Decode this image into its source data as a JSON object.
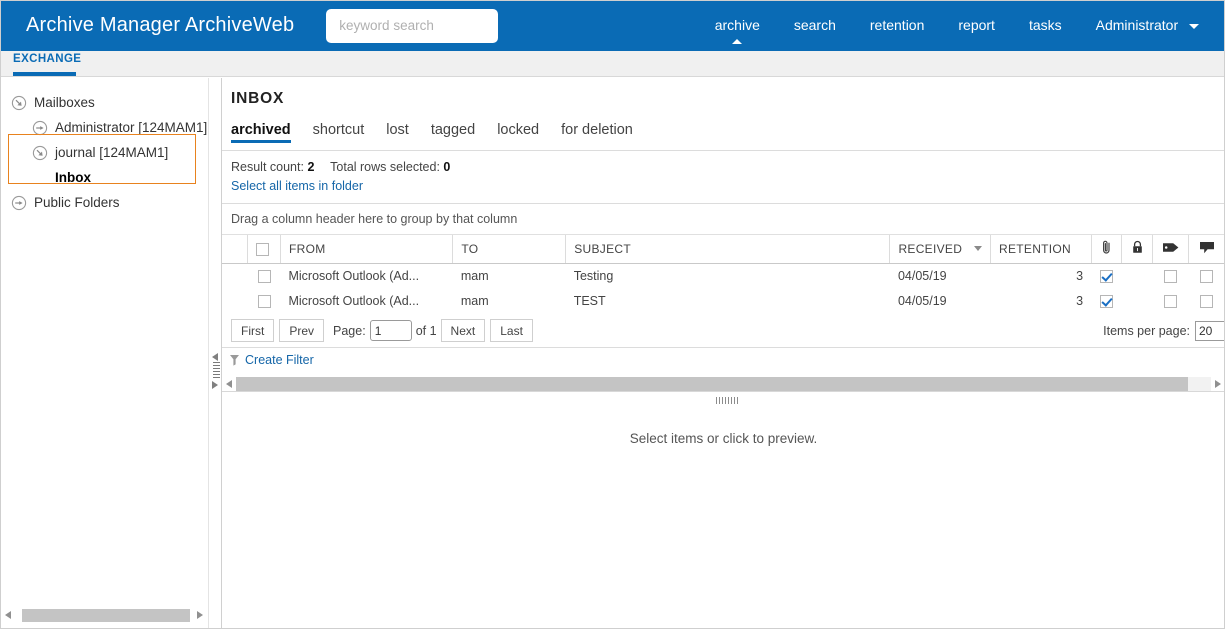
{
  "app": {
    "brand": "Archive Manager ArchiveWeb",
    "accent_blue": "#0a6bb5",
    "selection_orange": "#e8821e",
    "link_blue": "#1566a8"
  },
  "search": {
    "placeholder": "keyword search",
    "value": ""
  },
  "topnav": {
    "items": [
      {
        "label": "archive",
        "active": true
      },
      {
        "label": "search",
        "active": false
      },
      {
        "label": "retention",
        "active": false
      },
      {
        "label": "report",
        "active": false
      },
      {
        "label": "tasks",
        "active": false
      }
    ],
    "user_label": "Administrator"
  },
  "module_tab": {
    "label": "EXCHANGE"
  },
  "sidebar": {
    "tree": [
      {
        "label": "Mailboxes",
        "level": 0,
        "icon": "expanded-node-icon",
        "bold": false
      },
      {
        "label": "Administrator [124MAM1]",
        "level": 1,
        "icon": "collapsed-node-icon",
        "bold": false
      },
      {
        "label": "journal [124MAM1]",
        "level": 1,
        "icon": "expanded-node-icon",
        "bold": false
      },
      {
        "label": "Inbox",
        "level": 2,
        "icon": "none",
        "bold": true
      },
      {
        "label": "Public Folders",
        "level": 0,
        "icon": "collapsed-node-icon",
        "bold": false
      }
    ],
    "selected_label": "journal [124MAM1]"
  },
  "main": {
    "page_title": "INBOX",
    "tabs": [
      {
        "label": "archived",
        "active": true
      },
      {
        "label": "shortcut",
        "active": false
      },
      {
        "label": "lost",
        "active": false
      },
      {
        "label": "tagged",
        "active": false
      },
      {
        "label": "locked",
        "active": false
      },
      {
        "label": "for deletion",
        "active": false
      }
    ],
    "result_count_label": "Result count:",
    "result_count_value": "2",
    "total_selected_label": "Total rows selected:",
    "total_selected_value": "0",
    "select_all_link": "Select all items in folder",
    "group_hint": "Drag a column header here to group by that column",
    "preview_placeholder": "Select items or click to preview."
  },
  "grid": {
    "columns": [
      {
        "key": "spacer",
        "label": "",
        "type": "blank"
      },
      {
        "key": "select",
        "label": "",
        "type": "checkbox"
      },
      {
        "key": "from",
        "label": "FROM",
        "type": "text"
      },
      {
        "key": "to",
        "label": "TO",
        "type": "text"
      },
      {
        "key": "subject",
        "label": "SUBJECT",
        "type": "text"
      },
      {
        "key": "received",
        "label": "RECEIVED",
        "type": "text",
        "sortable": true
      },
      {
        "key": "retention",
        "label": "RETENTION",
        "type": "number"
      },
      {
        "key": "attachment",
        "label": "",
        "type": "icon",
        "icon": "paperclip-icon"
      },
      {
        "key": "locked",
        "label": "",
        "type": "icon",
        "icon": "lock-icon"
      },
      {
        "key": "tag",
        "label": "",
        "type": "icon",
        "icon": "tag-icon"
      },
      {
        "key": "comment",
        "label": "",
        "type": "icon",
        "icon": "comment-icon"
      }
    ],
    "rows": [
      {
        "selected": false,
        "from": "Microsoft Outlook (Ad...",
        "to": "mam",
        "subject": "Testing",
        "received": "04/05/19",
        "retention": "3",
        "attachment": true,
        "locked": null,
        "tag": false,
        "comment": false
      },
      {
        "selected": false,
        "from": "Microsoft Outlook (Ad...",
        "to": "mam",
        "subject": "TEST",
        "received": "04/05/19",
        "retention": "3",
        "attachment": true,
        "locked": null,
        "tag": false,
        "comment": false
      }
    ],
    "header_select_all": false
  },
  "pager": {
    "first": "First",
    "prev": "Prev",
    "page_label": "Page:",
    "page_value": "1",
    "of_label": "of 1",
    "next": "Next",
    "last": "Last",
    "items_per_page_label": "Items per page:",
    "items_per_page_value": "20"
  },
  "filter": {
    "link": "Create Filter",
    "icon": "funnel-icon"
  }
}
